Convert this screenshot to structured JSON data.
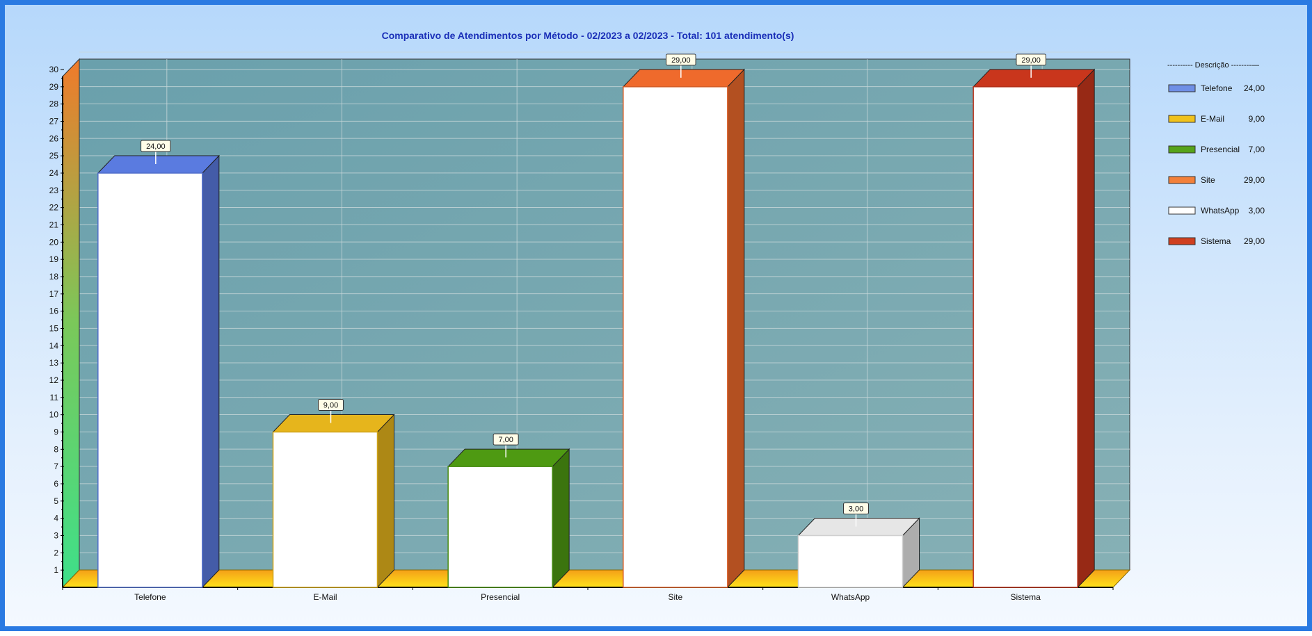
{
  "chart_data": {
    "type": "bar",
    "title": "Comparativo de Atendimentos por Método - 02/2023 a 02/2023 - Total: 101 atendimento(s)",
    "categories": [
      "Telefone",
      "E-Mail",
      "Presencial",
      "Site",
      "WhatsApp",
      "Sistema"
    ],
    "values": [
      24,
      9,
      7,
      29,
      3,
      29
    ],
    "value_labels": [
      "24,00",
      "9,00",
      "7,00",
      "29,00",
      "3,00",
      "29,00"
    ],
    "ylim": [
      0,
      30
    ],
    "yticks": [
      1,
      2,
      3,
      4,
      5,
      6,
      7,
      8,
      9,
      10,
      11,
      12,
      13,
      14,
      15,
      16,
      17,
      18,
      19,
      20,
      21,
      22,
      23,
      24,
      25,
      26,
      27,
      28,
      29,
      30
    ],
    "grid": true,
    "three_d": true,
    "colors": [
      "#5a7be0",
      "#e6b51c",
      "#4e9a12",
      "#ef6a2c",
      "#e6e6e6",
      "#c9361c"
    ],
    "legend": {
      "placement": "right",
      "header": "---------- Descrição --------—",
      "entries": [
        {
          "label": "Telefone",
          "value": "24,00",
          "color": "#6f8fe6",
          "highlight": false
        },
        {
          "label": "E-Mail",
          "value": "9,00",
          "color": "#f0c21c",
          "highlight": false
        },
        {
          "label": "Presencial",
          "value": "7,00",
          "color": "#56a31a",
          "highlight": false
        },
        {
          "label": "Site",
          "value": "29,00",
          "color": "#f3803a",
          "highlight": true
        },
        {
          "label": "WhatsApp",
          "value": "3,00",
          "color": "#ffffff",
          "highlight": false
        },
        {
          "label": "Sistema",
          "value": "29,00",
          "color": "#cf3f1f",
          "highlight": false
        }
      ]
    }
  }
}
